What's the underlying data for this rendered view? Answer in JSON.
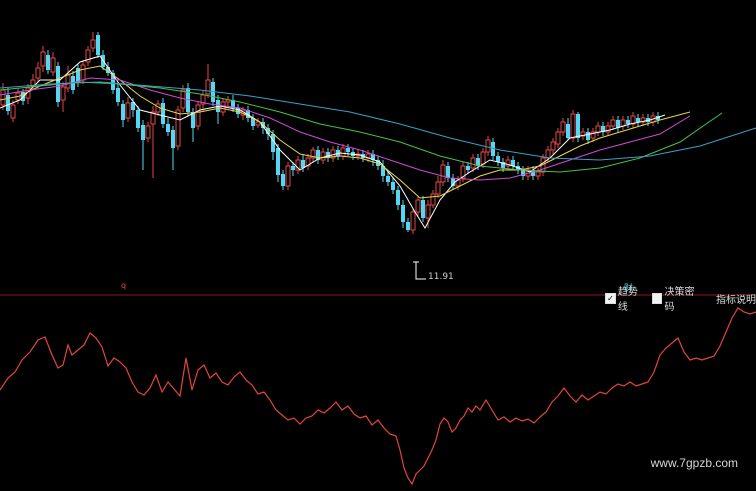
{
  "colors": {
    "background": "#000000",
    "up_candle": "#e04848",
    "down_candle": "#53d7f2",
    "divider": "#8a1a1a",
    "indicator_line": "#e0473c",
    "ma5": "#ffffff",
    "ma10": "#e8d84a",
    "ma20": "#d04ad8",
    "ma30": "#48c048",
    "ma60": "#3aa0c8"
  },
  "markers": {
    "low_value": "11.91",
    "left_tag": "q",
    "right_tag": "财"
  },
  "legend": {
    "trend_label": "趋势线",
    "trend_checked": true,
    "decision_label": "决策密码",
    "decision_checked": false,
    "indicator_link": "指标说明"
  },
  "watermark": "www.7gpzb.com",
  "candles": [
    [
      3,
      105,
      90,
      83,
      110
    ],
    [
      8,
      95,
      111,
      88,
      115
    ],
    [
      13,
      118,
      105,
      100,
      122
    ],
    [
      18,
      100,
      93,
      88,
      104
    ],
    [
      23,
      92,
      101,
      89,
      105
    ],
    [
      28,
      98,
      88,
      84,
      104
    ],
    [
      33,
      86,
      80,
      74,
      90
    ],
    [
      38,
      78,
      68,
      62,
      82
    ],
    [
      43,
      66,
      52,
      46,
      72
    ],
    [
      48,
      55,
      70,
      50,
      74
    ],
    [
      53,
      72,
      58,
      52,
      76
    ],
    [
      58,
      66,
      102,
      62,
      107
    ],
    [
      63,
      100,
      87,
      82,
      112
    ],
    [
      68,
      88,
      75,
      66,
      92
    ],
    [
      73,
      76,
      90,
      71,
      94
    ],
    [
      78,
      68,
      82,
      64,
      87
    ],
    [
      83,
      80,
      65,
      60,
      84
    ],
    [
      88,
      62,
      50,
      46,
      66
    ],
    [
      93,
      48,
      40,
      32,
      52
    ],
    [
      98,
      35,
      55,
      32,
      58
    ],
    [
      103,
      55,
      67,
      50,
      70
    ],
    [
      108,
      67,
      73,
      62,
      76
    ],
    [
      113,
      73,
      90,
      70,
      94
    ],
    [
      118,
      88,
      102,
      82,
      106
    ],
    [
      123,
      104,
      120,
      100,
      127
    ],
    [
      128,
      118,
      103,
      97,
      122
    ],
    [
      133,
      102,
      110,
      98,
      117
    ],
    [
      138,
      110,
      128,
      106,
      132
    ],
    [
      143,
      125,
      140,
      120,
      170
    ],
    [
      148,
      138,
      126,
      122,
      142
    ],
    [
      153,
      124,
      112,
      106,
      178
    ],
    [
      158,
      112,
      104,
      100,
      116
    ],
    [
      163,
      103,
      124,
      98,
      128
    ],
    [
      168,
      124,
      132,
      118,
      136
    ],
    [
      173,
      130,
      148,
      126,
      170
    ],
    [
      178,
      146,
      110,
      106,
      150
    ],
    [
      183,
      108,
      90,
      85,
      112
    ],
    [
      188,
      88,
      112,
      83,
      116
    ],
    [
      193,
      112,
      128,
      108,
      142
    ],
    [
      198,
      126,
      105,
      101,
      130
    ],
    [
      203,
      104,
      95,
      90,
      112
    ],
    [
      208,
      94,
      80,
      64,
      98
    ],
    [
      213,
      82,
      102,
      78,
      106
    ],
    [
      218,
      100,
      112,
      95,
      124
    ],
    [
      223,
      112,
      102,
      98,
      116
    ],
    [
      228,
      102,
      100,
      96,
      106
    ],
    [
      233,
      100,
      108,
      95,
      112
    ],
    [
      238,
      108,
      114,
      104,
      118
    ],
    [
      243,
      115,
      110,
      107,
      120
    ],
    [
      248,
      110,
      118,
      106,
      122
    ],
    [
      253,
      118,
      126,
      114,
      130
    ],
    [
      258,
      125,
      122,
      118,
      128
    ],
    [
      263,
      122,
      128,
      118,
      134
    ],
    [
      268,
      128,
      134,
      124,
      140
    ],
    [
      273,
      134,
      152,
      130,
      160
    ],
    [
      278,
      148,
      175,
      144,
      182
    ],
    [
      283,
      174,
      186,
      170,
      190
    ],
    [
      288,
      186,
      166,
      162,
      190
    ],
    [
      293,
      166,
      170,
      162,
      176
    ],
    [
      298,
      170,
      160,
      156,
      174
    ],
    [
      303,
      160,
      168,
      155,
      172
    ],
    [
      308,
      166,
      158,
      154,
      170
    ],
    [
      313,
      158,
      150,
      147,
      162
    ],
    [
      318,
      150,
      160,
      146,
      164
    ],
    [
      323,
      160,
      152,
      148,
      164
    ],
    [
      328,
      152,
      158,
      148,
      162
    ],
    [
      333,
      158,
      150,
      146,
      162
    ],
    [
      338,
      150,
      156,
      146,
      160
    ],
    [
      343,
      156,
      148,
      144,
      160
    ],
    [
      348,
      148,
      152,
      144,
      156
    ],
    [
      353,
      152,
      156,
      148,
      160
    ],
    [
      358,
      156,
      154,
      150,
      160
    ],
    [
      363,
      154,
      158,
      150,
      162
    ],
    [
      368,
      158,
      154,
      150,
      162
    ],
    [
      373,
      154,
      160,
      150,
      166
    ],
    [
      378,
      160,
      166,
      156,
      170
    ],
    [
      383,
      166,
      176,
      160,
      182
    ],
    [
      388,
      176,
      182,
      172,
      186
    ],
    [
      393,
      182,
      190,
      178,
      194
    ],
    [
      398,
      190,
      205,
      186,
      210
    ],
    [
      403,
      205,
      222,
      200,
      228
    ],
    [
      408,
      222,
      230,
      218,
      232
    ],
    [
      413,
      230,
      212,
      208,
      234
    ],
    [
      418,
      212,
      200,
      196,
      216
    ],
    [
      423,
      200,
      218,
      196,
      222
    ],
    [
      428,
      218,
      205,
      200,
      228
    ],
    [
      433,
      205,
      194,
      190,
      208
    ],
    [
      438,
      194,
      182,
      176,
      198
    ],
    [
      443,
      182,
      165,
      160,
      186
    ],
    [
      448,
      166,
      178,
      162,
      182
    ],
    [
      453,
      178,
      186,
      174,
      190
    ],
    [
      458,
      186,
      180,
      176,
      190
    ],
    [
      463,
      178,
      166,
      162,
      182
    ],
    [
      468,
      166,
      170,
      162,
      174
    ],
    [
      473,
      168,
      158,
      154,
      172
    ],
    [
      478,
      158,
      166,
      154,
      170
    ],
    [
      483,
      164,
      152,
      148,
      168
    ],
    [
      488,
      152,
      140,
      136,
      156
    ],
    [
      493,
      142,
      156,
      138,
      160
    ],
    [
      498,
      156,
      162,
      152,
      166
    ],
    [
      503,
      162,
      168,
      158,
      172
    ],
    [
      508,
      166,
      160,
      156,
      170
    ],
    [
      513,
      160,
      166,
      156,
      170
    ],
    [
      518,
      166,
      170,
      162,
      174
    ],
    [
      523,
      170,
      176,
      166,
      180
    ],
    [
      528,
      176,
      170,
      166,
      180
    ],
    [
      533,
      170,
      176,
      166,
      180
    ],
    [
      538,
      176,
      172,
      168,
      180
    ],
    [
      543,
      172,
      158,
      154,
      176
    ],
    [
      548,
      158,
      150,
      146,
      162
    ],
    [
      553,
      150,
      142,
      138,
      154
    ],
    [
      558,
      144,
      132,
      128,
      148
    ],
    [
      563,
      132,
      122,
      118,
      136
    ],
    [
      568,
      124,
      138,
      118,
      140
    ],
    [
      573,
      138,
      114,
      110,
      142
    ],
    [
      578,
      114,
      138,
      112,
      142
    ],
    [
      583,
      136,
      132,
      128,
      140
    ],
    [
      588,
      132,
      140,
      128,
      144
    ],
    [
      593,
      138,
      132,
      128,
      142
    ],
    [
      598,
      132,
      126,
      122,
      136
    ],
    [
      603,
      126,
      132,
      122,
      136
    ],
    [
      608,
      132,
      126,
      122,
      136
    ],
    [
      613,
      126,
      120,
      116,
      130
    ],
    [
      618,
      120,
      128,
      116,
      132
    ],
    [
      623,
      126,
      120,
      116,
      130
    ],
    [
      628,
      120,
      124,
      116,
      128
    ],
    [
      633,
      124,
      116,
      112,
      128
    ],
    [
      638,
      118,
      122,
      114,
      126
    ],
    [
      643,
      122,
      118,
      114,
      126
    ],
    [
      648,
      118,
      122,
      114,
      126
    ],
    [
      653,
      122,
      116,
      112,
      126
    ],
    [
      658,
      116,
      120,
      112,
      124
    ]
  ],
  "ma_lines": {
    "ma5": [
      [
        0,
        108
      ],
      [
        20,
        100
      ],
      [
        40,
        80
      ],
      [
        60,
        80
      ],
      [
        80,
        62
      ],
      [
        100,
        56
      ],
      [
        120,
        85
      ],
      [
        140,
        110
      ],
      [
        160,
        115
      ],
      [
        180,
        120
      ],
      [
        200,
        110
      ],
      [
        220,
        106
      ],
      [
        240,
        110
      ],
      [
        260,
        122
      ],
      [
        280,
        150
      ],
      [
        300,
        170
      ],
      [
        320,
        158
      ],
      [
        340,
        153
      ],
      [
        360,
        155
      ],
      [
        380,
        162
      ],
      [
        400,
        186
      ],
      [
        415,
        212
      ],
      [
        425,
        228
      ],
      [
        440,
        200
      ],
      [
        455,
        182
      ],
      [
        470,
        172
      ],
      [
        490,
        160
      ],
      [
        510,
        165
      ],
      [
        530,
        172
      ],
      [
        550,
        158
      ],
      [
        570,
        138
      ],
      [
        590,
        134
      ],
      [
        610,
        130
      ],
      [
        630,
        124
      ],
      [
        650,
        120
      ],
      [
        665,
        115
      ]
    ],
    "ma10": [
      [
        0,
        100
      ],
      [
        20,
        96
      ],
      [
        40,
        86
      ],
      [
        60,
        78
      ],
      [
        80,
        70
      ],
      [
        100,
        66
      ],
      [
        120,
        80
      ],
      [
        140,
        96
      ],
      [
        160,
        108
      ],
      [
        180,
        114
      ],
      [
        200,
        112
      ],
      [
        220,
        108
      ],
      [
        240,
        112
      ],
      [
        260,
        122
      ],
      [
        280,
        140
      ],
      [
        300,
        154
      ],
      [
        320,
        158
      ],
      [
        340,
        156
      ],
      [
        360,
        158
      ],
      [
        380,
        164
      ],
      [
        400,
        180
      ],
      [
        420,
        198
      ],
      [
        440,
        196
      ],
      [
        460,
        186
      ],
      [
        480,
        176
      ],
      [
        500,
        170
      ],
      [
        520,
        170
      ],
      [
        540,
        166
      ],
      [
        560,
        156
      ],
      [
        580,
        146
      ],
      [
        600,
        138
      ],
      [
        620,
        132
      ],
      [
        640,
        126
      ],
      [
        660,
        120
      ],
      [
        690,
        112
      ]
    ],
    "ma20": [
      [
        0,
        95
      ],
      [
        30,
        90
      ],
      [
        60,
        86
      ],
      [
        90,
        78
      ],
      [
        120,
        80
      ],
      [
        150,
        90
      ],
      [
        180,
        98
      ],
      [
        210,
        104
      ],
      [
        240,
        108
      ],
      [
        270,
        118
      ],
      [
        300,
        132
      ],
      [
        330,
        142
      ],
      [
        360,
        150
      ],
      [
        390,
        160
      ],
      [
        420,
        170
      ],
      [
        450,
        178
      ],
      [
        480,
        180
      ],
      [
        510,
        178
      ],
      [
        540,
        170
      ],
      [
        570,
        160
      ],
      [
        600,
        150
      ],
      [
        630,
        142
      ],
      [
        660,
        134
      ],
      [
        690,
        116
      ]
    ],
    "ma30": [
      [
        0,
        90
      ],
      [
        40,
        86
      ],
      [
        80,
        82
      ],
      [
        120,
        84
      ],
      [
        160,
        88
      ],
      [
        200,
        94
      ],
      [
        240,
        102
      ],
      [
        280,
        112
      ],
      [
        320,
        124
      ],
      [
        360,
        132
      ],
      [
        400,
        142
      ],
      [
        440,
        156
      ],
      [
        480,
        166
      ],
      [
        520,
        170
      ],
      [
        560,
        172
      ],
      [
        600,
        168
      ],
      [
        640,
        158
      ],
      [
        680,
        142
      ],
      [
        722,
        113
      ]
    ],
    "ma60": [
      [
        0,
        88
      ],
      [
        50,
        84
      ],
      [
        100,
        82
      ],
      [
        150,
        86
      ],
      [
        200,
        90
      ],
      [
        250,
        96
      ],
      [
        300,
        104
      ],
      [
        350,
        112
      ],
      [
        400,
        124
      ],
      [
        450,
        138
      ],
      [
        500,
        150
      ],
      [
        550,
        158
      ],
      [
        600,
        160
      ],
      [
        650,
        156
      ],
      [
        700,
        146
      ],
      [
        756,
        128
      ]
    ]
  },
  "indicator": [
    [
      0,
      390
    ],
    [
      8,
      378
    ],
    [
      15,
      372
    ],
    [
      22,
      360
    ],
    [
      30,
      352
    ],
    [
      38,
      340
    ],
    [
      45,
      337
    ],
    [
      52,
      355
    ],
    [
      58,
      368
    ],
    [
      63,
      365
    ],
    [
      68,
      345
    ],
    [
      72,
      355
    ],
    [
      78,
      350
    ],
    [
      84,
      345
    ],
    [
      90,
      333
    ],
    [
      96,
      338
    ],
    [
      102,
      347
    ],
    [
      108,
      366
    ],
    [
      114,
      358
    ],
    [
      120,
      362
    ],
    [
      126,
      368
    ],
    [
      132,
      382
    ],
    [
      138,
      392
    ],
    [
      144,
      395
    ],
    [
      150,
      388
    ],
    [
      156,
      375
    ],
    [
      162,
      392
    ],
    [
      168,
      382
    ],
    [
      174,
      389
    ],
    [
      180,
      396
    ],
    [
      186,
      358
    ],
    [
      192,
      390
    ],
    [
      198,
      370
    ],
    [
      204,
      365
    ],
    [
      210,
      378
    ],
    [
      216,
      373
    ],
    [
      222,
      382
    ],
    [
      228,
      385
    ],
    [
      234,
      377
    ],
    [
      240,
      372
    ],
    [
      246,
      380
    ],
    [
      252,
      385
    ],
    [
      258,
      394
    ],
    [
      264,
      392
    ],
    [
      270,
      400
    ],
    [
      276,
      410
    ],
    [
      282,
      415
    ],
    [
      288,
      420
    ],
    [
      294,
      418
    ],
    [
      300,
      424
    ],
    [
      306,
      418
    ],
    [
      312,
      416
    ],
    [
      318,
      410
    ],
    [
      324,
      413
    ],
    [
      330,
      408
    ],
    [
      336,
      402
    ],
    [
      342,
      410
    ],
    [
      348,
      406
    ],
    [
      354,
      414
    ],
    [
      360,
      418
    ],
    [
      366,
      416
    ],
    [
      372,
      425
    ],
    [
      378,
      420
    ],
    [
      384,
      428
    ],
    [
      390,
      434
    ],
    [
      396,
      436
    ],
    [
      400,
      450
    ],
    [
      404,
      468
    ],
    [
      408,
      478
    ],
    [
      412,
      484
    ],
    [
      416,
      474
    ],
    [
      420,
      470
    ],
    [
      424,
      466
    ],
    [
      428,
      458
    ],
    [
      432,
      450
    ],
    [
      436,
      440
    ],
    [
      440,
      424
    ],
    [
      444,
      418
    ],
    [
      448,
      422
    ],
    [
      452,
      432
    ],
    [
      456,
      428
    ],
    [
      460,
      420
    ],
    [
      464,
      416
    ],
    [
      468,
      408
    ],
    [
      472,
      412
    ],
    [
      476,
      406
    ],
    [
      480,
      410
    ],
    [
      486,
      400
    ],
    [
      492,
      410
    ],
    [
      498,
      420
    ],
    [
      504,
      417
    ],
    [
      510,
      422
    ],
    [
      516,
      418
    ],
    [
      522,
      421
    ],
    [
      528,
      419
    ],
    [
      534,
      423
    ],
    [
      540,
      417
    ],
    [
      546,
      412
    ],
    [
      552,
      402
    ],
    [
      558,
      396
    ],
    [
      564,
      388
    ],
    [
      570,
      396
    ],
    [
      576,
      402
    ],
    [
      582,
      395
    ],
    [
      588,
      400
    ],
    [
      594,
      396
    ],
    [
      600,
      392
    ],
    [
      606,
      394
    ],
    [
      612,
      388
    ],
    [
      618,
      384
    ],
    [
      624,
      386
    ],
    [
      630,
      382
    ],
    [
      636,
      386
    ],
    [
      642,
      384
    ],
    [
      648,
      382
    ],
    [
      654,
      372
    ],
    [
      660,
      355
    ],
    [
      666,
      348
    ],
    [
      672,
      343
    ],
    [
      678,
      338
    ],
    [
      684,
      352
    ],
    [
      690,
      360
    ],
    [
      696,
      358
    ],
    [
      702,
      360
    ],
    [
      708,
      358
    ],
    [
      714,
      356
    ],
    [
      720,
      346
    ],
    [
      726,
      332
    ],
    [
      732,
      318
    ],
    [
      738,
      308
    ],
    [
      744,
      312
    ],
    [
      750,
      314
    ],
    [
      756,
      312
    ]
  ]
}
